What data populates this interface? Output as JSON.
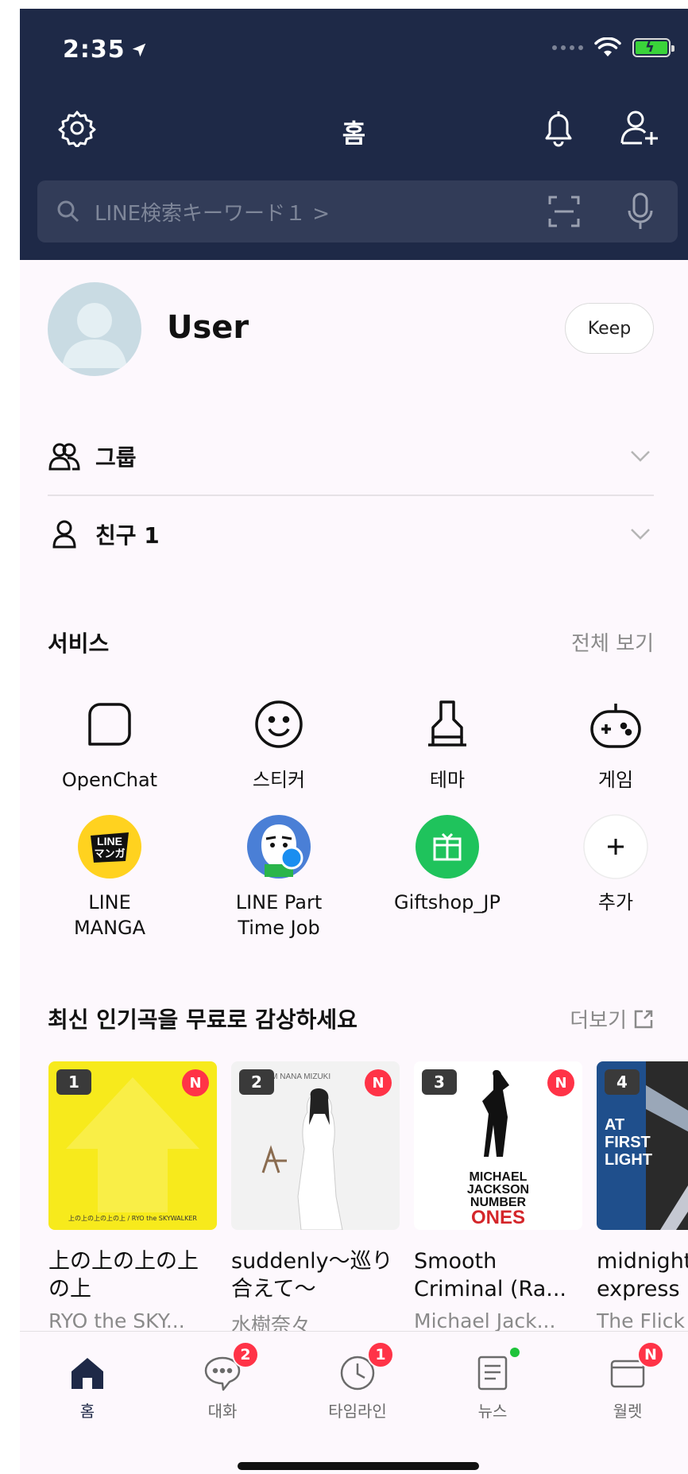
{
  "status_bar": {
    "time": "2:35"
  },
  "header": {
    "title": "홈",
    "search_placeholder": "LINE検索キーワード１ >"
  },
  "profile": {
    "name": "User",
    "keep_label": "Keep"
  },
  "lists": [
    {
      "label": "그룹"
    },
    {
      "label": "친구 1"
    }
  ],
  "services": {
    "title": "서비스",
    "see_all": "전체 보기",
    "items": [
      {
        "label": "OpenChat",
        "icon": "openchat-icon"
      },
      {
        "label": "스티커",
        "icon": "sticker-icon"
      },
      {
        "label": "테마",
        "icon": "theme-icon"
      },
      {
        "label": "게임",
        "icon": "game-icon"
      },
      {
        "label": "LINE MANGA",
        "icon": "line-manga-icon",
        "badge_text": "LINE マンガ"
      },
      {
        "label": "LINE Part Time Job",
        "icon": "line-part-time-job-icon"
      },
      {
        "label": "Giftshop_JP",
        "icon": "gift-icon"
      },
      {
        "label": "추가",
        "icon": "add-icon"
      }
    ]
  },
  "music": {
    "title": "최신 인기곡을 무료로 감상하세요",
    "more": "더보기",
    "cards": [
      {
        "rank": "1",
        "badge": "N",
        "title": "上の上の上の上の上",
        "artist": "RYO the SKY...",
        "cover_color": "#f7ea1c",
        "cover_caption": "上の上の上の上の上  /  RYO the SKYWALKER"
      },
      {
        "rank": "2",
        "badge": "N",
        "title": "suddenly～巡り合えて～",
        "artist": "水樹奈々",
        "cover_color": "#f2f2f2",
        "cover_caption": "MUSEUM NANA MIZUKI"
      },
      {
        "rank": "3",
        "badge": "N",
        "title": "Smooth Criminal (Ra...",
        "artist": "Michael Jack...",
        "cover_color": "#ffffff",
        "cover_caption": "MICHAEL JACKSON NUMBER ONES"
      },
      {
        "rank": "4",
        "badge": "",
        "title": "midnight express",
        "artist": "The Flick",
        "cover_color": "#1f4f8c",
        "cover_caption": "AT FIRST LIGHT The FLICKERS"
      }
    ]
  },
  "tabs": [
    {
      "label": "홈",
      "icon": "home-icon",
      "badge": ""
    },
    {
      "label": "대화",
      "icon": "chat-icon",
      "badge": "2"
    },
    {
      "label": "타임라인",
      "icon": "timeline-icon",
      "badge": "1"
    },
    {
      "label": "뉴스",
      "icon": "news-icon",
      "badge": ""
    },
    {
      "label": "월렛",
      "icon": "wallet-icon",
      "badge": "N"
    }
  ],
  "colors": {
    "header_bg": "#1e2947",
    "badge_red": "#ff3347",
    "gift_green": "#1fc35c",
    "manga_yellow": "#ffd21f"
  }
}
